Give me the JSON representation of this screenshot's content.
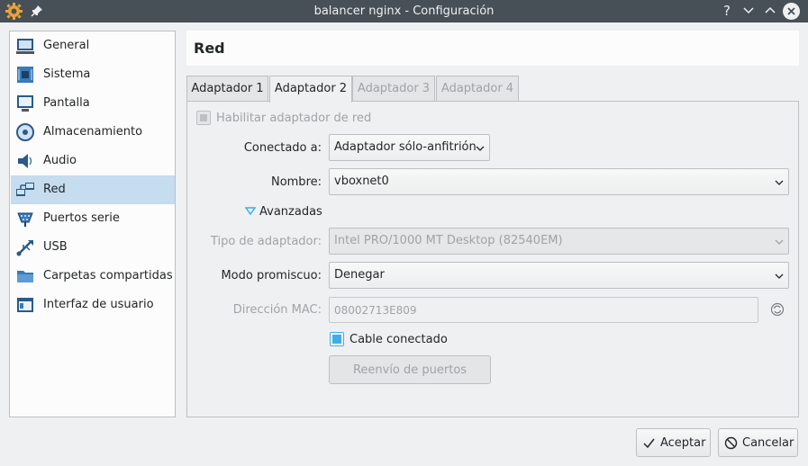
{
  "window": {
    "title": "balancer nginx - Configuración",
    "help": "?"
  },
  "sidebar": {
    "items": [
      {
        "label": "General",
        "icon": "general-icon"
      },
      {
        "label": "Sistema",
        "icon": "system-icon"
      },
      {
        "label": "Pantalla",
        "icon": "display-icon"
      },
      {
        "label": "Almacenamiento",
        "icon": "storage-icon"
      },
      {
        "label": "Audio",
        "icon": "audio-icon"
      },
      {
        "label": "Red",
        "icon": "network-icon",
        "selected": true
      },
      {
        "label": "Puertos serie",
        "icon": "serial-ports-icon"
      },
      {
        "label": "USB",
        "icon": "usb-icon"
      },
      {
        "label": "Carpetas compartidas",
        "icon": "shared-folders-icon"
      },
      {
        "label": "Interfaz de usuario",
        "icon": "user-interface-icon"
      }
    ]
  },
  "page": {
    "title": "Red"
  },
  "tabs": [
    {
      "label": "Adaptador 1",
      "state": "normal"
    },
    {
      "label": "Adaptador 2",
      "state": "active"
    },
    {
      "label": "Adaptador 3",
      "state": "disabled"
    },
    {
      "label": "Adaptador 4",
      "state": "disabled"
    }
  ],
  "form": {
    "enable_adapter_label": "Habilitar adaptador de red",
    "attached_to_label": "Conectado a:",
    "attached_to_value": "Adaptador sólo-anfitrión",
    "name_label": "Nombre:",
    "name_value": "vboxnet0",
    "advanced_label": "Avanzadas",
    "adapter_type_label": "Tipo de adaptador:",
    "adapter_type_value": "Intel PRO/1000 MT Desktop (82540EM)",
    "promiscuous_label": "Modo promiscuo:",
    "promiscuous_value": "Denegar",
    "mac_label": "Dirección MAC:",
    "mac_value": "08002713E809",
    "cable_label": "Cable conectado",
    "cable_checked": true,
    "port_forwarding_label": "Reenvío de puertos"
  },
  "footer": {
    "accept_label": "Aceptar",
    "cancel_label": "Cancelar"
  },
  "colors": {
    "titlebar": "#475057",
    "selection": "#c6dcef",
    "accent": "#3daee9"
  }
}
